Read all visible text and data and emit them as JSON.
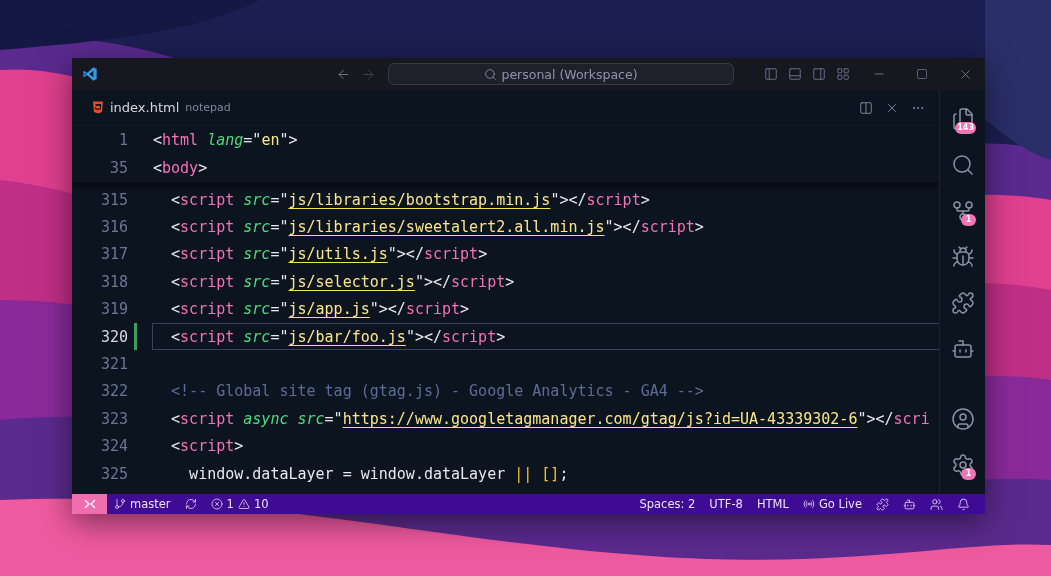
{
  "title_bar": {
    "command_center": "personal (Workspace)"
  },
  "tab": {
    "filename": "index.html",
    "description": "notepad"
  },
  "sticky_lines": [
    {
      "number": "1",
      "tokens": [
        {
          "kind": "punct",
          "text": "<"
        },
        {
          "kind": "tag",
          "text": "html"
        },
        {
          "kind": "attr",
          "text": " lang"
        },
        {
          "kind": "punct",
          "text": "=\""
        },
        {
          "kind": "string",
          "text": "en"
        },
        {
          "kind": "punct",
          "text": "\">"
        }
      ]
    },
    {
      "number": "35",
      "tokens": [
        {
          "kind": "punct",
          "text": "<"
        },
        {
          "kind": "tag",
          "text": "body"
        },
        {
          "kind": "punct",
          "text": ">"
        }
      ]
    }
  ],
  "lines": [
    {
      "number": "315",
      "current": false,
      "modified": false,
      "tokens": [
        {
          "kind": "punct",
          "text": "  <"
        },
        {
          "kind": "tag",
          "text": "script"
        },
        {
          "kind": "attr",
          "text": " src"
        },
        {
          "kind": "punct",
          "text": "=\""
        },
        {
          "kind": "link",
          "text": "js/libraries/bootstrap.min.js"
        },
        {
          "kind": "punct",
          "text": "\"></"
        },
        {
          "kind": "tag",
          "text": "script"
        },
        {
          "kind": "punct",
          "text": ">"
        }
      ]
    },
    {
      "number": "316",
      "current": false,
      "modified": false,
      "tokens": [
        {
          "kind": "punct",
          "text": "  <"
        },
        {
          "kind": "tag",
          "text": "script"
        },
        {
          "kind": "attr",
          "text": " src"
        },
        {
          "kind": "punct",
          "text": "=\""
        },
        {
          "kind": "link",
          "text": "js/libraries/sweetalert2.all.min.js"
        },
        {
          "kind": "punct",
          "text": "\"></"
        },
        {
          "kind": "tag",
          "text": "script"
        },
        {
          "kind": "punct",
          "text": ">"
        }
      ]
    },
    {
      "number": "317",
      "current": false,
      "modified": false,
      "tokens": [
        {
          "kind": "punct",
          "text": "  <"
        },
        {
          "kind": "tag",
          "text": "script"
        },
        {
          "kind": "attr",
          "text": " src"
        },
        {
          "kind": "punct",
          "text": "=\""
        },
        {
          "kind": "link",
          "text": "js/utils.js"
        },
        {
          "kind": "punct",
          "text": "\"></"
        },
        {
          "kind": "tag",
          "text": "script"
        },
        {
          "kind": "punct",
          "text": ">"
        }
      ]
    },
    {
      "number": "318",
      "current": false,
      "modified": false,
      "tokens": [
        {
          "kind": "punct",
          "text": "  <"
        },
        {
          "kind": "tag",
          "text": "script"
        },
        {
          "kind": "attr",
          "text": " src"
        },
        {
          "kind": "punct",
          "text": "=\""
        },
        {
          "kind": "link",
          "text": "js/selector.js"
        },
        {
          "kind": "punct",
          "text": "\"></"
        },
        {
          "kind": "tag",
          "text": "script"
        },
        {
          "kind": "punct",
          "text": ">"
        }
      ]
    },
    {
      "number": "319",
      "current": false,
      "modified": false,
      "tokens": [
        {
          "kind": "punct",
          "text": "  <"
        },
        {
          "kind": "tag",
          "text": "script"
        },
        {
          "kind": "attr",
          "text": " src"
        },
        {
          "kind": "punct",
          "text": "=\""
        },
        {
          "kind": "link",
          "text": "js/app.js"
        },
        {
          "kind": "punct",
          "text": "\"></"
        },
        {
          "kind": "tag",
          "text": "script"
        },
        {
          "kind": "punct",
          "text": ">"
        }
      ]
    },
    {
      "number": "320",
      "current": true,
      "modified": true,
      "tokens": [
        {
          "kind": "punct",
          "text": "  <"
        },
        {
          "kind": "tag",
          "text": "script"
        },
        {
          "kind": "attr",
          "text": " src"
        },
        {
          "kind": "punct",
          "text": "=\""
        },
        {
          "kind": "link",
          "text": "js/bar/foo.js"
        },
        {
          "kind": "punct",
          "text": "\"></"
        },
        {
          "kind": "tag",
          "text": "script"
        },
        {
          "kind": "punct",
          "text": ">"
        }
      ]
    },
    {
      "number": "321",
      "current": false,
      "modified": false
    },
    {
      "number": "322",
      "current": false,
      "modified": false,
      "tokens": [
        {
          "kind": "comment",
          "text": "  <!-- Global site tag (gtag.js) - Google Analytics - GA4 -->"
        }
      ]
    },
    {
      "number": "323",
      "current": false,
      "modified": false,
      "tokens": [
        {
          "kind": "punct",
          "text": "  <"
        },
        {
          "kind": "tag",
          "text": "script"
        },
        {
          "kind": "attr",
          "text": " async src"
        },
        {
          "kind": "punct",
          "text": "=\""
        },
        {
          "kind": "link",
          "text": "https://www.googletagmanager.com/gtag/js?id=UA-43339302-6"
        },
        {
          "kind": "punct",
          "text": "\"></"
        },
        {
          "kind": "tag",
          "text": "scri"
        }
      ]
    },
    {
      "number": "324",
      "current": false,
      "modified": false,
      "tokens": [
        {
          "kind": "punct",
          "text": "  <"
        },
        {
          "kind": "tag",
          "text": "script"
        },
        {
          "kind": "punct",
          "text": ">"
        }
      ]
    },
    {
      "number": "325",
      "current": false,
      "modified": false,
      "tokens": [
        {
          "kind": "plain",
          "text": "    window.dataLayer = window.dataLayer "
        },
        {
          "kind": "bracket",
          "text": "|| []"
        },
        {
          "kind": "plain",
          "text": ";"
        }
      ]
    }
  ],
  "activity_bar": {
    "top": [
      {
        "kind": "files",
        "badge": "143"
      },
      {
        "kind": "search"
      },
      {
        "kind": "source-control",
        "badge": "1"
      },
      {
        "kind": "debug"
      },
      {
        "kind": "extensions"
      },
      {
        "kind": "robot"
      }
    ],
    "bottom": [
      {
        "kind": "account"
      },
      {
        "kind": "settings",
        "badge": "1"
      }
    ]
  },
  "status_bar": {
    "branch": "master",
    "errors": "1",
    "warnings": "10",
    "items": [
      "Spaces: 2",
      "UTF-8",
      "HTML"
    ],
    "go_live": "Go Live",
    "icons": [
      {
        "kind": "extension"
      },
      {
        "kind": "robot"
      },
      {
        "kind": "people"
      },
      {
        "kind": "bell"
      }
    ]
  }
}
